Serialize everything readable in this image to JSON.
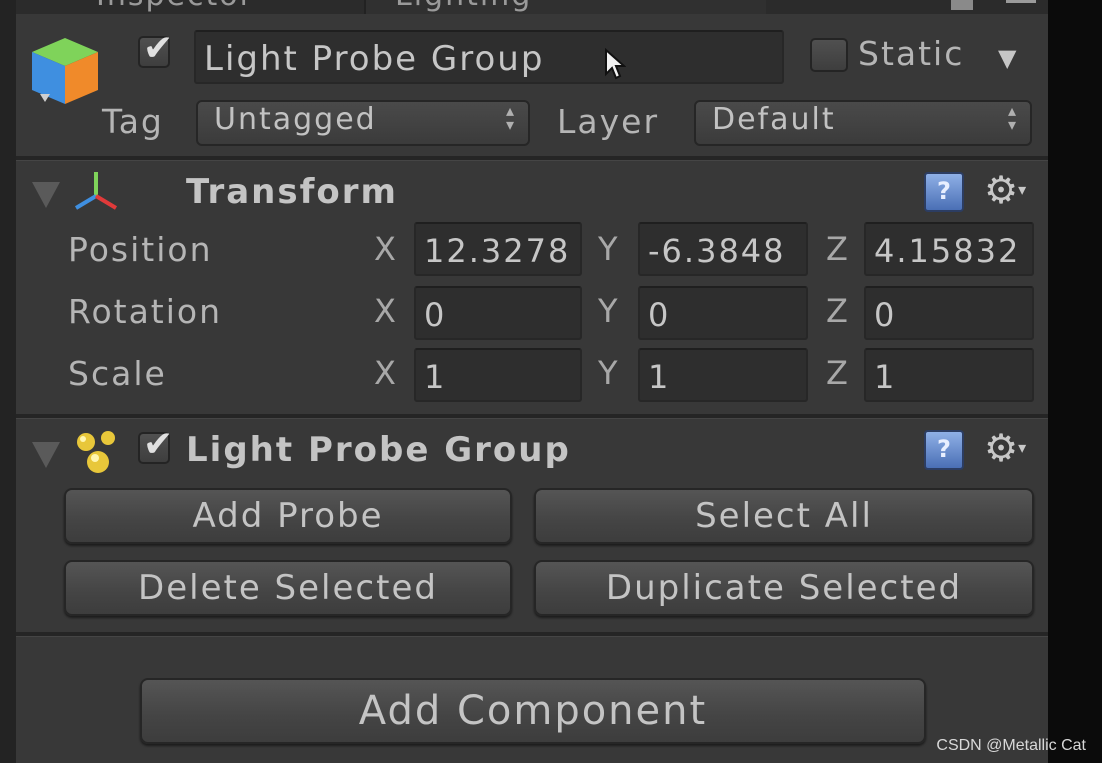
{
  "tabs": [
    {
      "label": "Inspector"
    },
    {
      "label": "Lighting"
    }
  ],
  "header": {
    "active": true,
    "object_name": "Light Probe Group",
    "static_label": "Static",
    "static_checked": false,
    "tag_label": "Tag",
    "tag_value": "Untagged",
    "layer_label": "Layer",
    "layer_value": "Default"
  },
  "transform": {
    "title": "Transform",
    "rows": [
      {
        "label": "Position",
        "x": "12.3278",
        "y": "-6.3848",
        "z": "4.15832"
      },
      {
        "label": "Rotation",
        "x": "0",
        "y": "0",
        "z": "0"
      },
      {
        "label": "Scale",
        "x": "1",
        "y": "1",
        "z": "1"
      }
    ],
    "axis_x": "X",
    "axis_y": "Y",
    "axis_z": "Z"
  },
  "light_probe_group": {
    "title": "Light Probe Group",
    "enabled": true,
    "buttons": {
      "add_probe": "Add Probe",
      "select_all": "Select All",
      "delete_selected": "Delete Selected",
      "duplicate_selected": "Duplicate Selected"
    }
  },
  "add_component_label": "Add Component",
  "watermark": "CSDN @Metallic Cat",
  "icons": {
    "checkmark": "✔",
    "help": "?",
    "gear": "⚙",
    "dropdown": "▼",
    "updown": "▲▼"
  },
  "colors": {
    "panel_bg": "#383838",
    "field_bg": "#2e2e2e",
    "text": "#c4c4c4",
    "help_icon": "#6c8fd0"
  }
}
